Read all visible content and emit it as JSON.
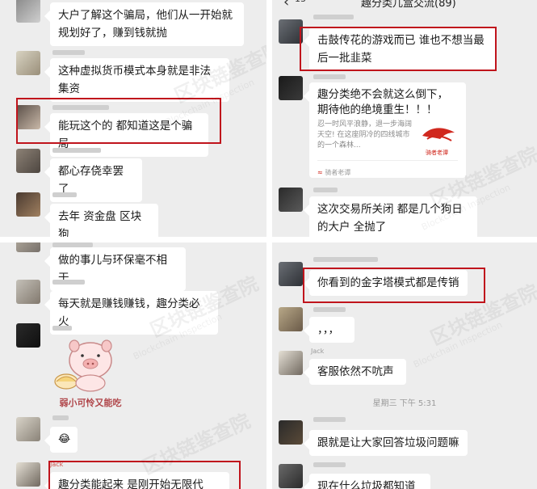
{
  "header": {
    "back_badge": "13",
    "title": "趣分类儿盒交流(89)"
  },
  "left_messages": {
    "m1": "大户了解这个骗局，他们从一开始就规划好了，赚到钱就抛",
    "m2": "这种虚拟货币模式本身就是非法集资",
    "m3": "能玩这个的 都知道这是个骗局",
    "m4": "都心存侥幸罢了",
    "m5": "去年 资金盘 区块狗",
    "m6": "做的事儿与环保毫不相干",
    "m7": "每天就是赚钱赚钱，趣分类必火",
    "m9": "趣分类能起来    是刚开始无限代"
  },
  "right_messages": {
    "m1": "击鼓传花的游戏而已 谁也不想当最后一批韭菜",
    "m2_title": "趣分类绝不会就这么倒下，期待他的绝境重生！！！",
    "m2_desc": "忍一时风平浪静，退一步海阔天空! 在这座阴冷的四线城市的一个森林...",
    "m2_source": "骑者老谭",
    "m2_logo_text": "骑者老谭",
    "m3": "这次交易所关闭 都是几个狗日的大户 全抛了",
    "m4": "你看到的金字塔模式都是传销",
    "m5": "，，，",
    "m6": "客服依然不吭声",
    "m7": "跟就是让大家回答垃圾问题嘛",
    "m8": "现在什么垃圾都知道"
  },
  "timestamp": "星期三 下午 5:31",
  "sticker": {
    "caption": "弱小可怜又能吃"
  },
  "small_emoji": "😂",
  "nicknames": {
    "jack": "Jack",
    "jack2": "Jack"
  },
  "watermark": {
    "cn": "区块链鉴查院",
    "en": "Blockchain Inspection"
  },
  "colors": {
    "chat_bg": "#ededed",
    "bubble_bg": "#ffffff",
    "highlight": "#c0141c",
    "text": "#1a1a1a"
  }
}
